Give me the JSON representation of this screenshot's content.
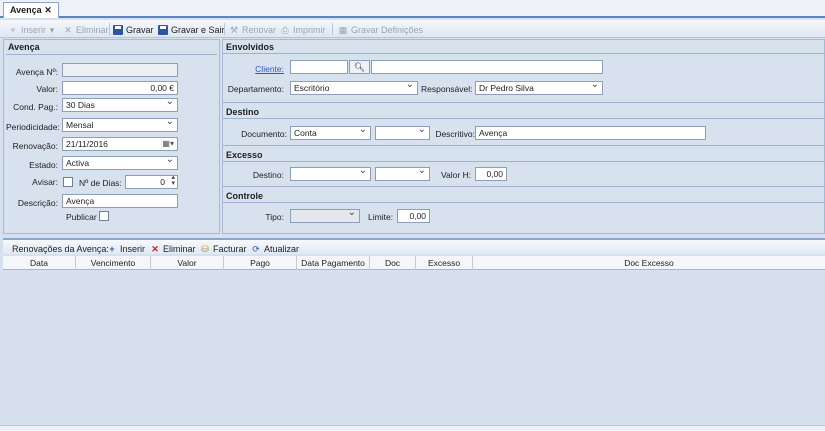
{
  "tab": {
    "title": "Avença",
    "close": "✕"
  },
  "toolbar": {
    "insert": "Inserir",
    "delete": "Eliminar",
    "save": "Gravar",
    "save_exit": "Gravar e Sair",
    "renew": "Renovar",
    "print": "Imprimir",
    "save_settings": "Gravar Definições"
  },
  "avenca": {
    "title": "Avença",
    "numero_label": "Avença Nº:",
    "numero_value": "",
    "valor_label": "Valor:",
    "valor_value": "0,00 €",
    "cond_pag_label": "Cond. Pag.:",
    "cond_pag_value": "30 Dias",
    "periodicidade_label": "Periodicidade:",
    "periodicidade_value": "Mensal",
    "renovacao_label": "Renovação:",
    "renovacao_value": "21/11/2016",
    "estado_label": "Estado:",
    "estado_value": "Activa",
    "avisar_label": "Avisar:",
    "n_dias_label": "Nº de Dias:",
    "n_dias_value": "0",
    "descricao_label": "Descrição:",
    "descricao_value": "Avença",
    "publicar_label": "Publicar"
  },
  "envolvidos": {
    "title": "Envolvidos",
    "cliente_label": "Cliente:",
    "cliente_code": "",
    "cliente_name": "",
    "departamento_label": "Departamento:",
    "departamento_value": "Escritório",
    "responsavel_label": "Responsável:",
    "responsavel_value": "Dr Pedro Silva"
  },
  "destino": {
    "title": "Destino",
    "documento_label": "Documento:",
    "documento_value": "Conta",
    "documento_serie": "",
    "descritivo_label": "Descritivo:",
    "descritivo_value": "Avença"
  },
  "excesso": {
    "title": "Excesso",
    "destino_label": "Destino:",
    "destino_value": "",
    "destino_serie": "",
    "valor_h_label": "Valor H:",
    "valor_h_value": "0,00"
  },
  "controle": {
    "title": "Controle",
    "tipo_label": "Tipo:",
    "tipo_value": "",
    "limite_label": "Limite:",
    "limite_value": "0,00"
  },
  "renovacoes": {
    "title": "Renovações da Avença:",
    "insert": "Inserir",
    "delete": "Eliminar",
    "facturar": "Facturar",
    "atualizar": "Atualizar",
    "columns": [
      "Data",
      "Vencimento",
      "Valor",
      "Pago",
      "Data Pagamento",
      "Doc",
      "Excesso",
      "Doc Excesso"
    ]
  },
  "colors": {
    "accent": "#2b59c3",
    "panel": "#d8e2ef",
    "delete": "#d02020"
  },
  "icons": {
    "search": "search-icon",
    "calendar": "calendar-icon",
    "save": "save-icon"
  }
}
